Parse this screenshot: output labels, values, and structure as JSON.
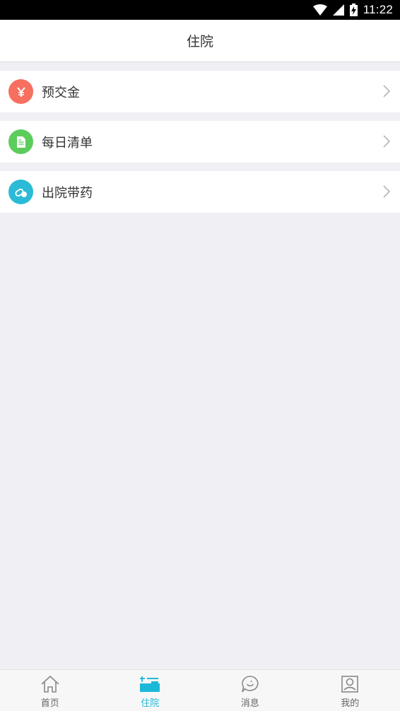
{
  "status_bar": {
    "time": "11:22",
    "icons": [
      "wifi-icon",
      "cell-signal-icon",
      "battery-charging-icon"
    ]
  },
  "header": {
    "title": "住院"
  },
  "menu": {
    "items": [
      {
        "label": "预交金",
        "icon": "yen-icon",
        "color": "#f76f5f"
      },
      {
        "label": "每日清单",
        "icon": "document-icon",
        "color": "#5ccc5c"
      },
      {
        "label": "出院带药",
        "icon": "medicine-pill-icon",
        "color": "#2bbbd6"
      }
    ]
  },
  "tabs": {
    "active_color": "#1cb8d8",
    "items": [
      {
        "label": "首页",
        "icon": "home-icon",
        "active": false
      },
      {
        "label": "住院",
        "icon": "hospital-bed-icon",
        "active": true
      },
      {
        "label": "消息",
        "icon": "chat-smile-icon",
        "active": false
      },
      {
        "label": "我的",
        "icon": "profile-icon",
        "active": false
      }
    ]
  }
}
